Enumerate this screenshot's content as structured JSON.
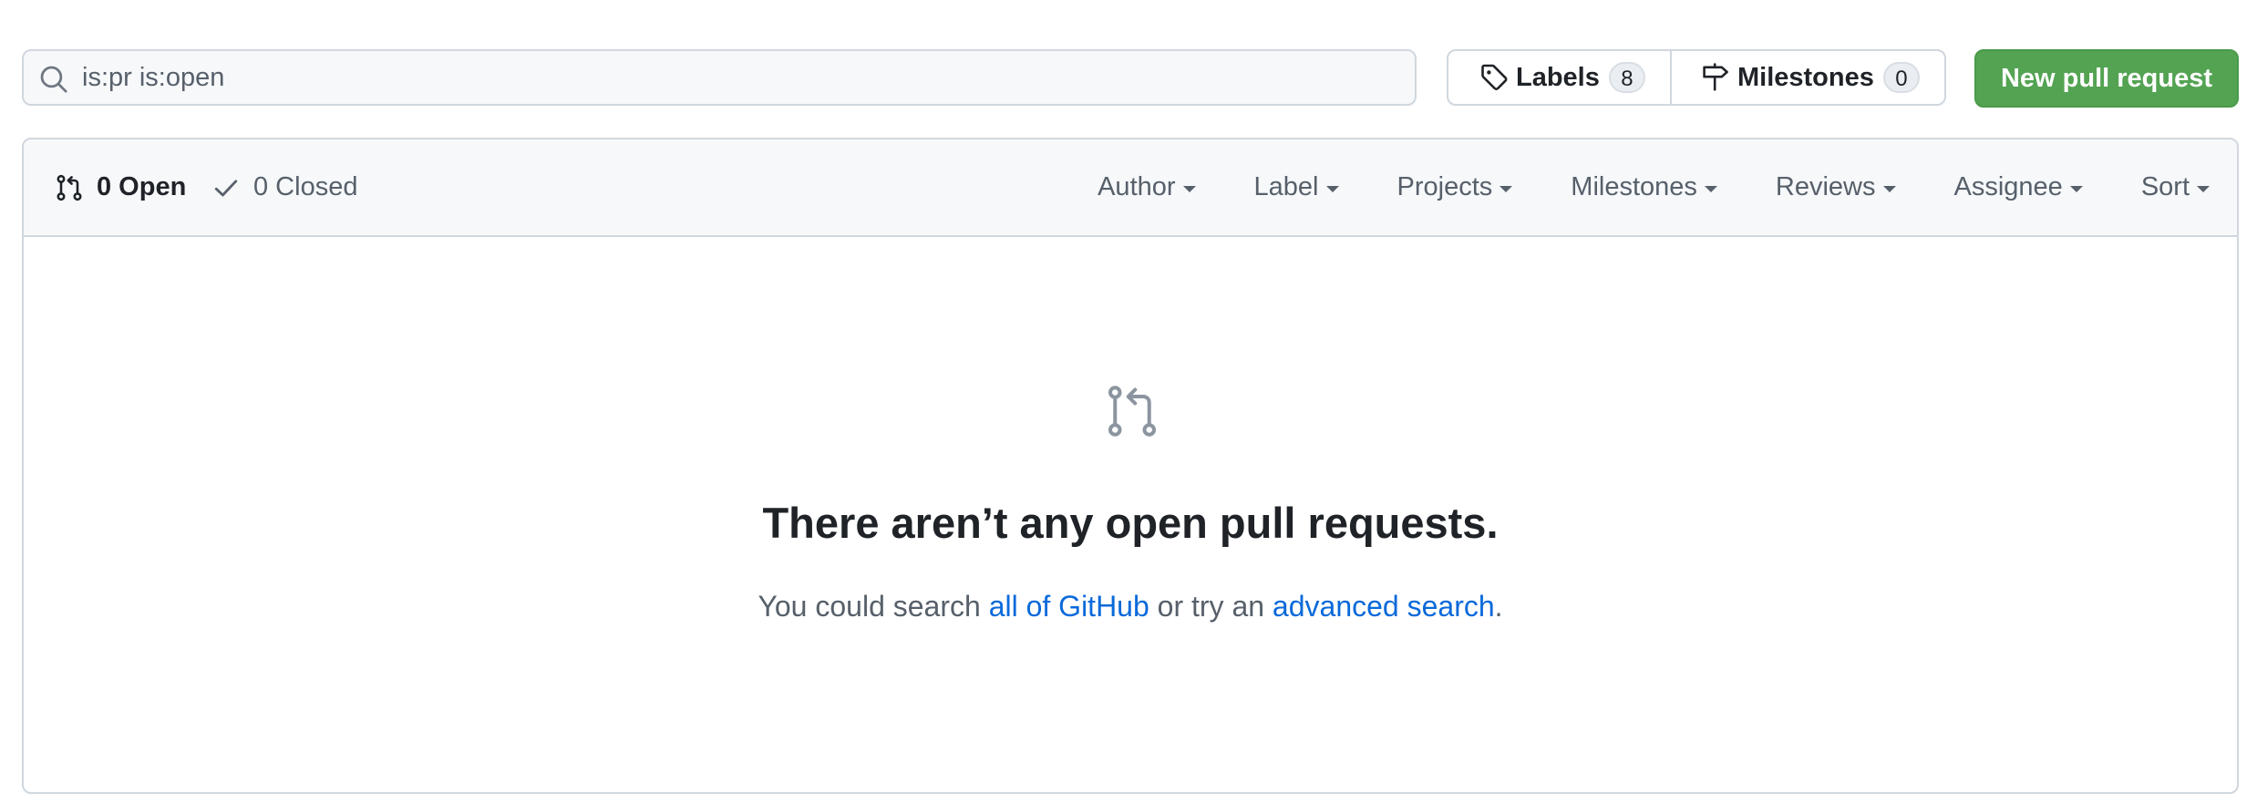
{
  "search": {
    "value": "is:pr is:open",
    "icon": "search-icon"
  },
  "labels": {
    "label": "Labels",
    "count": "8",
    "icon": "tag-icon"
  },
  "milestones": {
    "label": "Milestones",
    "count": "0",
    "icon": "milestone-icon"
  },
  "new_pr": {
    "label": "New pull request",
    "color": "#53a353"
  },
  "states": {
    "open": {
      "label": "0 Open",
      "icon": "git-pull-request-icon"
    },
    "closed": {
      "label": "0 Closed",
      "icon": "check-icon"
    }
  },
  "filters": [
    {
      "label": "Author"
    },
    {
      "label": "Label"
    },
    {
      "label": "Projects"
    },
    {
      "label": "Milestones"
    },
    {
      "label": "Reviews"
    },
    {
      "label": "Assignee"
    },
    {
      "label": "Sort"
    }
  ],
  "blankslate": {
    "icon": "git-pull-request-icon",
    "title": "There aren’t any open pull requests.",
    "desc_prefix": "You could search ",
    "link_all": "all of GitHub",
    "desc_middle": " or try an ",
    "link_advanced": "advanced search",
    "desc_suffix": "."
  },
  "colors": {
    "link": "#0969da",
    "border": "#d0d7de",
    "header_bg": "#f6f8fa",
    "muted_text": "#57606a"
  }
}
